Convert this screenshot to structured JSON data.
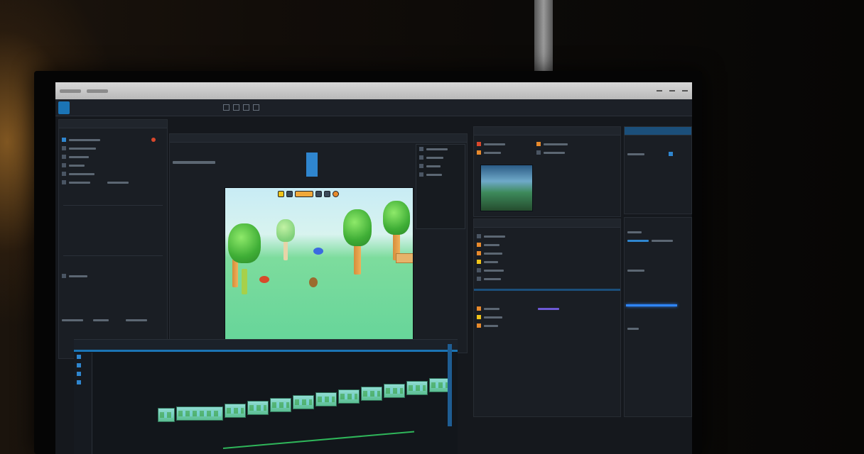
{
  "appbar": {
    "project_button": "",
    "menu": ""
  },
  "panels": {
    "left": {
      "title": ""
    },
    "viewport_tab": "",
    "inspector": {
      "title": ""
    },
    "assets": {
      "title": ""
    }
  },
  "viewport": {
    "scene": "game-scene"
  },
  "colors": {
    "accent": "#2f86cf",
    "track_green": "#2fb65a",
    "highlight_blue": "#2f86ff"
  }
}
